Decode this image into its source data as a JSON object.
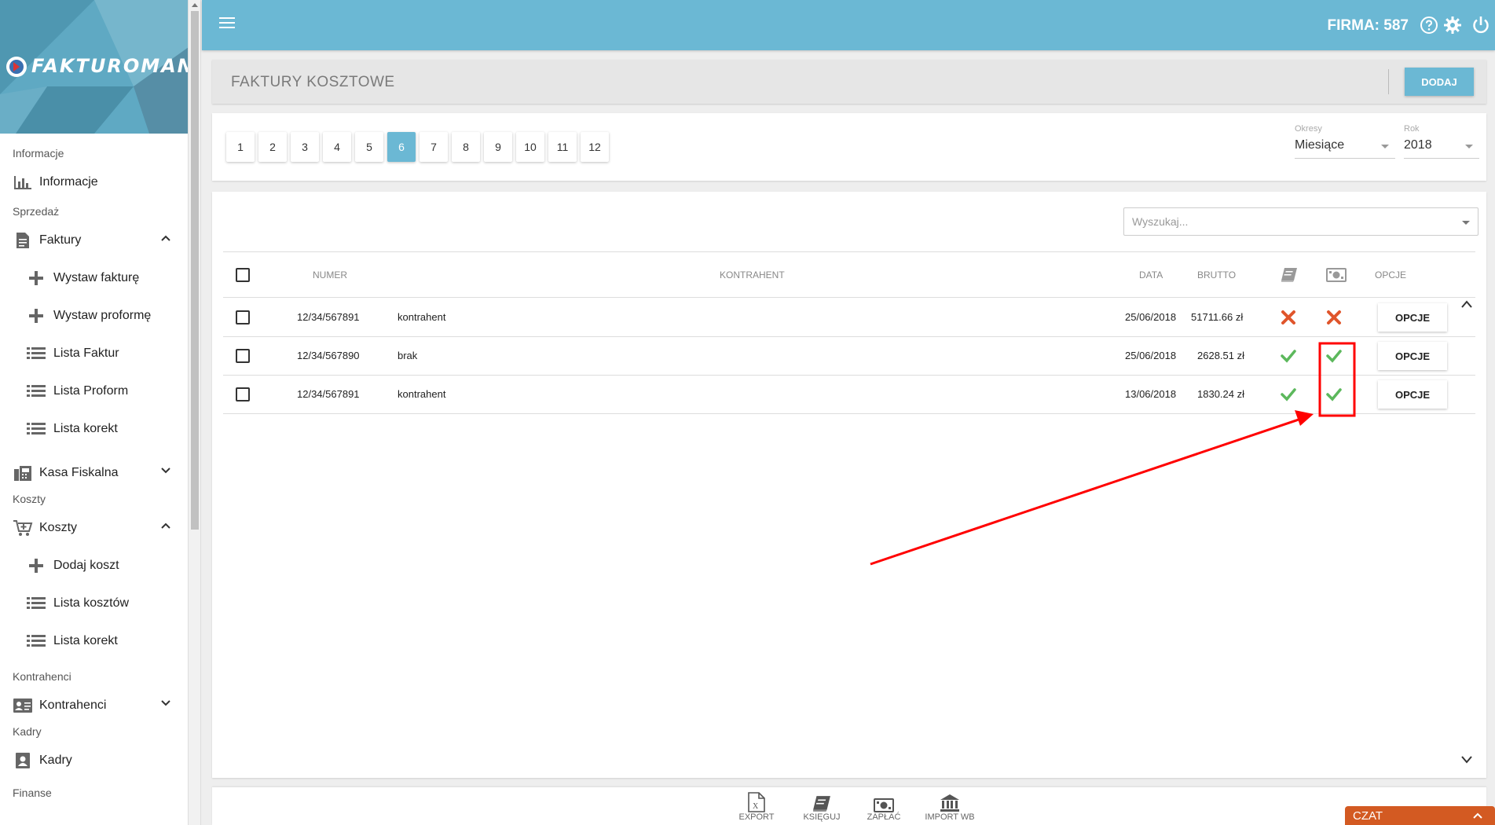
{
  "brand": {
    "logo_text": "FAKTUROMANIA",
    "color": "#5fa9c3"
  },
  "sidebar": {
    "sections": [
      {
        "label": "Informacje"
      },
      {
        "label": "Sprzedaż"
      },
      {
        "label": "Koszty"
      },
      {
        "label": "Kontrahenci"
      },
      {
        "label": "Kadry"
      },
      {
        "label": "Finanse"
      }
    ],
    "items": {
      "informacje": "Informacje",
      "faktury": "Faktury",
      "wystaw_fakture": "Wystaw fakturę",
      "wystaw_proforme": "Wystaw proformę",
      "lista_faktur": "Lista Faktur",
      "lista_proform": "Lista Proform",
      "lista_korekt": "Lista korekt",
      "kasa_fiskalna": "Kasa Fiskalna",
      "koszty": "Koszty",
      "dodaj_koszt": "Dodaj koszt",
      "lista_kosztow": "Lista kosztów",
      "lista_korekt_koszty": "Lista korekt",
      "kontrahenci": "Kontrahenci",
      "kadry": "Kadry"
    }
  },
  "header": {
    "firma": "FIRMA: 587",
    "accent": "#6bb8d4"
  },
  "page": {
    "title": "FAKTURY KOSZTOWE",
    "add_label": "DODAJ"
  },
  "pagination": {
    "pages": [
      "1",
      "2",
      "3",
      "4",
      "5",
      "6",
      "7",
      "8",
      "9",
      "10",
      "11",
      "12"
    ],
    "active": "6"
  },
  "filters": {
    "period_label": "Okresy",
    "period_value": "Miesiące",
    "year_label": "Rok",
    "year_value": "2018"
  },
  "search": {
    "placeholder": "Wyszukaj..."
  },
  "table": {
    "headers": {
      "numer": "NUMER",
      "kontrahent": "KONTRAHENT",
      "data": "DATA",
      "brutto": "BRUTTO",
      "opcje": "OPCJE"
    },
    "rows": [
      {
        "numer": "12/34/567891",
        "kontrahent": "kontrahent",
        "data": "25/06/2018",
        "brutto": "51711.66 zł",
        "booked": false,
        "paid": false,
        "option": "OPCJE"
      },
      {
        "numer": "12/34/567890",
        "kontrahent": "brak",
        "data": "25/06/2018",
        "brutto": "2628.51 zł",
        "booked": true,
        "paid": true,
        "option": "OPCJE"
      },
      {
        "numer": "12/34/567891",
        "kontrahent": "kontrahent",
        "data": "13/06/2018",
        "brutto": "1830.24 zł",
        "booked": true,
        "paid": true,
        "option": "OPCJE"
      }
    ]
  },
  "toolbar": {
    "export": "EXPORT",
    "ksieguj": "KSIĘGUJ",
    "zaplac": "ZAPŁAĆ",
    "import": "IMPORT WB"
  },
  "chat": {
    "label": "CZAT",
    "color": "#d35a22"
  },
  "colors": {
    "check": "#5cb85c",
    "cross": "#e0552b",
    "annotation": "#ff0000"
  }
}
